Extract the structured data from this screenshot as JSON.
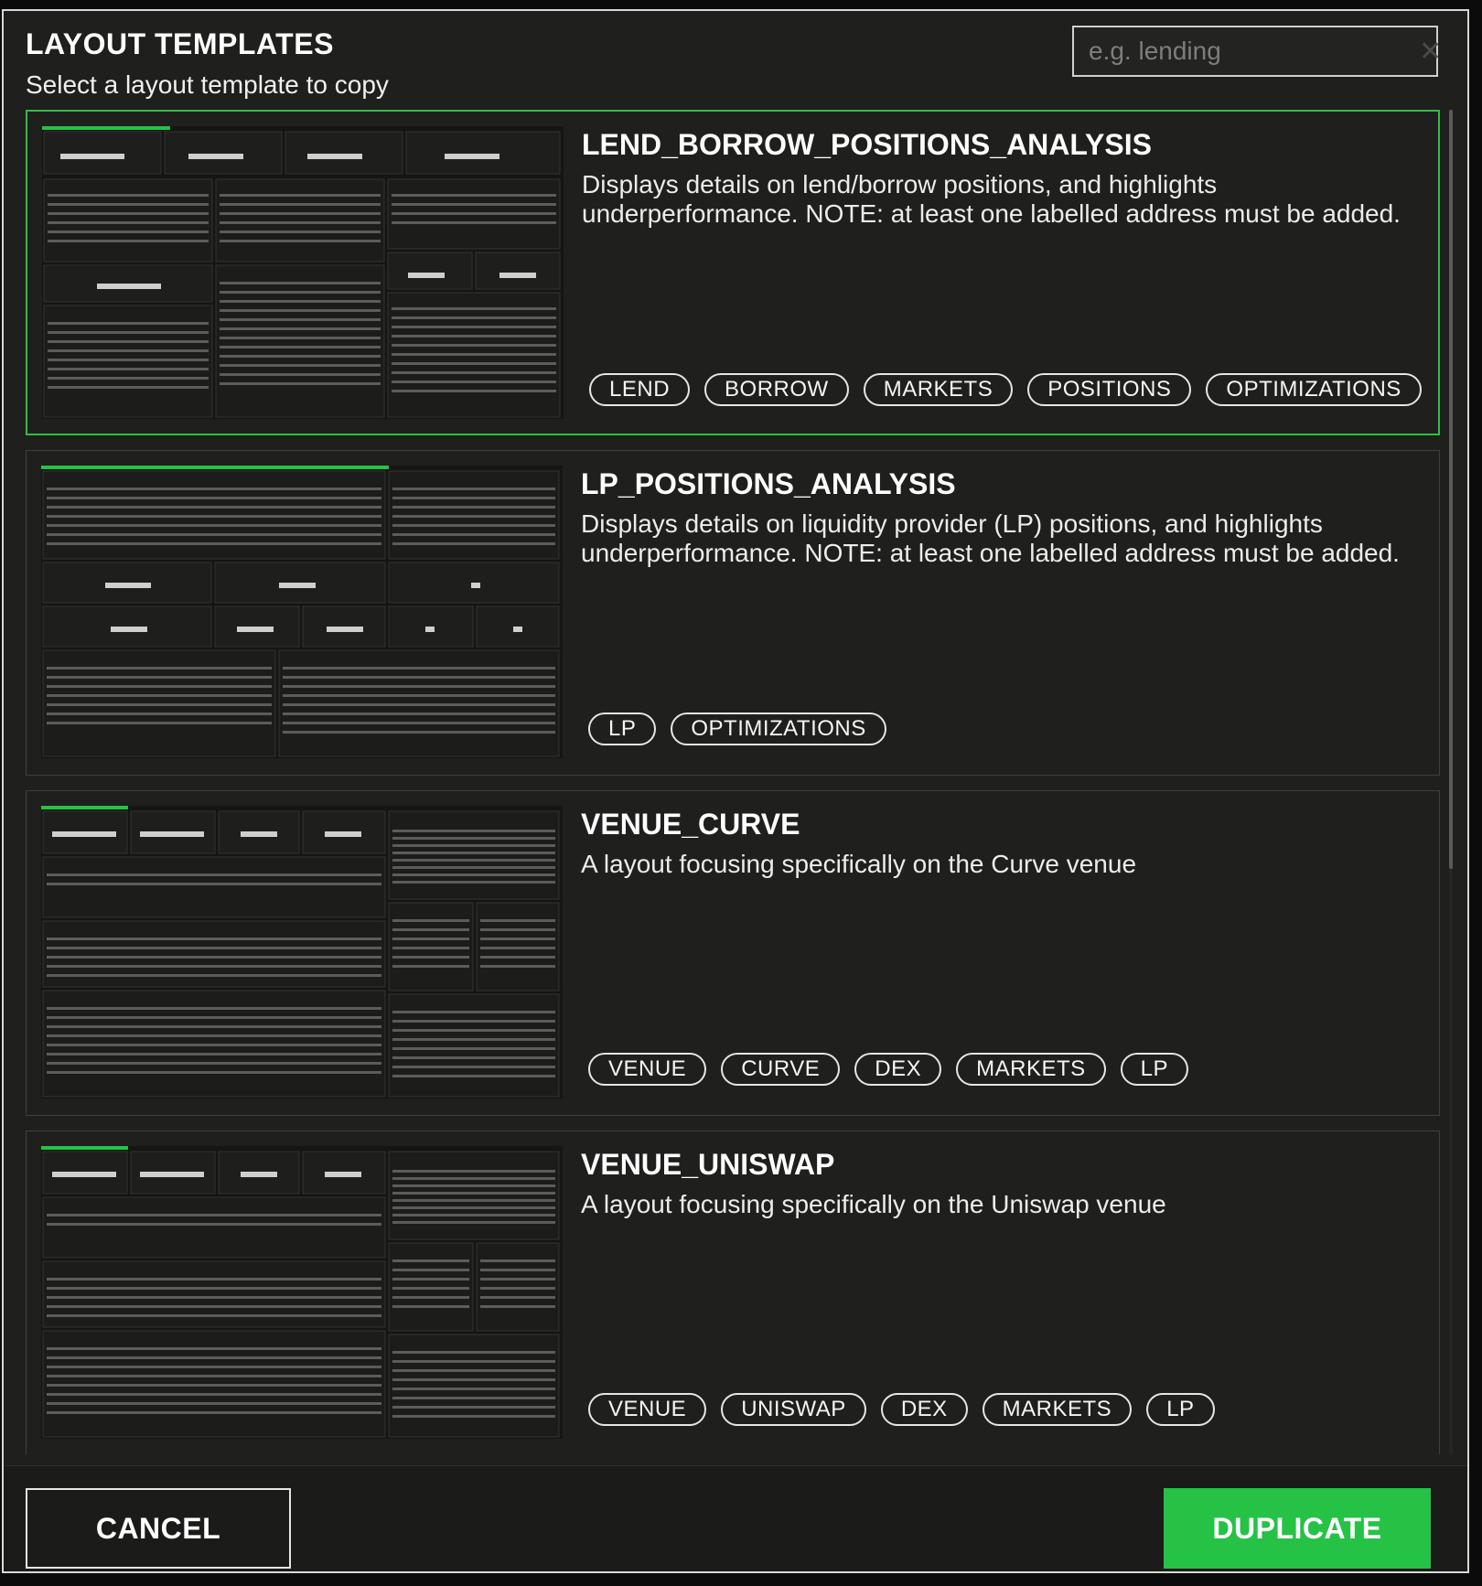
{
  "dialog": {
    "title": "LAYOUT TEMPLATES",
    "subtitle": "Select a layout template to copy"
  },
  "search": {
    "placeholder": "e.g. lending",
    "value": "",
    "clear_icon": "close-icon"
  },
  "templates": [
    {
      "name": "LEND_BORROW_POSITIONS_ANALYSIS",
      "description": "Displays details on lend/borrow positions, and highlights underperformance. NOTE: at least one labelled address must be added.",
      "selected": true,
      "tags": [
        "LEND",
        "BORROW",
        "MARKETS",
        "POSITIONS",
        "OPTIMIZATIONS"
      ]
    },
    {
      "name": "LP_POSITIONS_ANALYSIS",
      "description": "Displays details on liquidity provider (LP) positions, and highlights underperformance. NOTE: at least one labelled address must be added.",
      "selected": false,
      "tags": [
        "LP",
        "OPTIMIZATIONS"
      ]
    },
    {
      "name": "VENUE_CURVE",
      "description": "A layout focusing specifically on the Curve venue",
      "selected": false,
      "tags": [
        "VENUE",
        "CURVE",
        "DEX",
        "MARKETS",
        "LP"
      ]
    },
    {
      "name": "VENUE_UNISWAP",
      "description": "A layout focusing specifically on the Uniswap venue",
      "selected": false,
      "tags": [
        "VENUE",
        "UNISWAP",
        "DEX",
        "MARKETS",
        "LP"
      ]
    }
  ],
  "footer": {
    "cancel_label": "CANCEL",
    "duplicate_label": "DUPLICATE"
  },
  "colors": {
    "accent": "#25c246",
    "selected_border": "#2fbf45",
    "background": "#1f1f1d"
  }
}
